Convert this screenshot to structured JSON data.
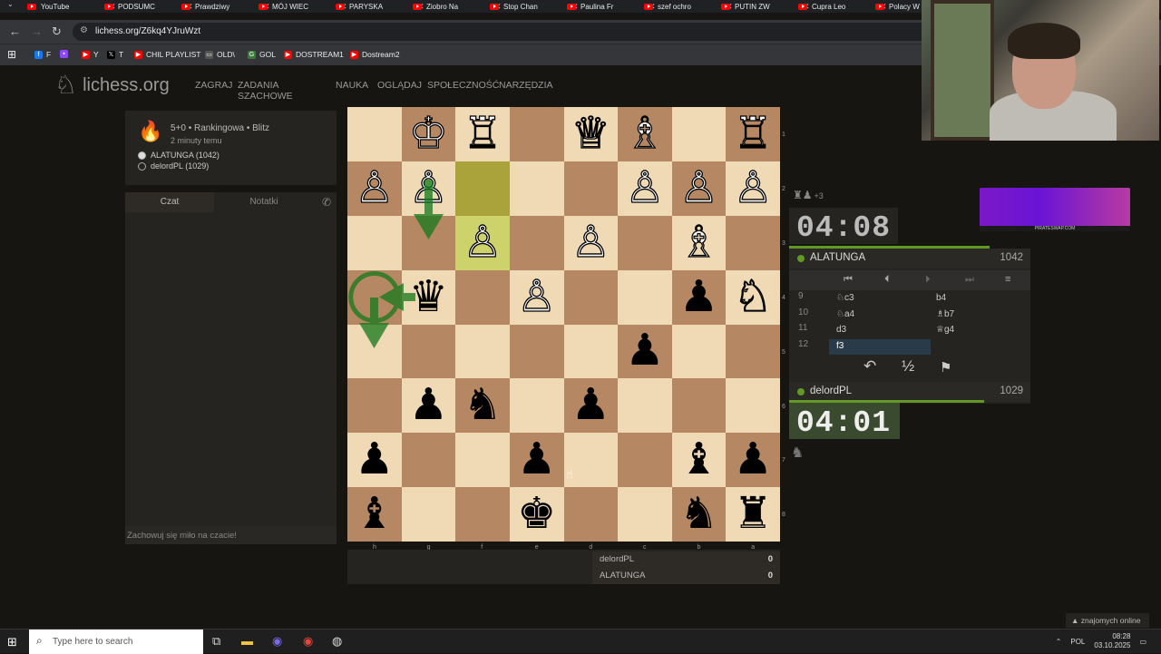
{
  "browser": {
    "tabs": [
      {
        "label": "YouTube",
        "icon": "youtube-icon"
      },
      {
        "label": "PODSUMC",
        "icon": "youtube-icon"
      },
      {
        "label": "Prawdziwy",
        "icon": "youtube-icon"
      },
      {
        "label": "MÓJ WIEC",
        "icon": "youtube-icon"
      },
      {
        "label": "PARYSKA",
        "icon": "youtube-icon"
      },
      {
        "label": "Ziobro Na",
        "icon": "youtube-icon"
      },
      {
        "label": "Stop Chan",
        "icon": "youtube-icon"
      },
      {
        "label": "Paulina Fr",
        "icon": "youtube-icon"
      },
      {
        "label": "szef ochro",
        "icon": "youtube-icon"
      },
      {
        "label": "PUTIN ZW",
        "icon": "youtube-icon"
      },
      {
        "label": "Cupra Leo",
        "icon": "youtube-icon"
      },
      {
        "label": "Polacy W",
        "icon": "youtube-icon"
      }
    ],
    "url": "lichess.org/Z6kq4YJruWzt",
    "bookmarks": [
      {
        "label": "F",
        "icon": "facebook-icon",
        "color": "#1877f2"
      },
      {
        "label": "",
        "icon": "twitch-icon",
        "color": "#9146ff"
      },
      {
        "label": "Y",
        "icon": "youtube-icon",
        "color": "#ff0000"
      },
      {
        "label": "T",
        "icon": "x-icon",
        "color": "#000000"
      },
      {
        "label": "CHIL PLAYLIST",
        "icon": "youtube-icon",
        "color": "#ff0000"
      },
      {
        "label": "OLD\\",
        "icon": "folder-icon",
        "color": "#555555"
      },
      {
        "label": "GOL",
        "icon": "g-icon",
        "color": "#3a7a3a"
      },
      {
        "label": "DOSTREAM1",
        "icon": "youtube-icon",
        "color": "#ff0000"
      },
      {
        "label": "Dostream2",
        "icon": "youtube-icon",
        "color": "#ff0000"
      }
    ]
  },
  "site": {
    "logo_text": "lichess.org",
    "nav": [
      "ZAGRAJ",
      "ZADANIA SZACHOWE",
      "NAUKA",
      "OGLĄDAJ",
      "SPOŁECZNOŚĆ",
      "NARZĘDZIA"
    ]
  },
  "game": {
    "type": "5+0 • Rankingowa • Blitz",
    "time_ago": "2 minuty temu",
    "white": "ALATUNGA (1042)",
    "black": "delordPL (1029)"
  },
  "chat": {
    "tab_chat": "Czat",
    "tab_notes": "Notatki",
    "placeholder": "Zachowuj się miło na czacie!"
  },
  "board": {
    "orientation": "black",
    "ranks": [
      "1",
      "2",
      "3",
      "4",
      "5",
      "6",
      "7",
      "8"
    ],
    "files": [
      "h",
      "g",
      "f",
      "e",
      "d",
      "c",
      "b",
      "a"
    ],
    "rows": [
      [
        "",
        "♔",
        "♖",
        "",
        "♕",
        "♗",
        "",
        "♖"
      ],
      [
        "♙",
        "♙",
        "",
        "",
        "",
        "♙",
        "♙",
        "♙"
      ],
      [
        "",
        "",
        "♙",
        "",
        "♙",
        "",
        "♗",
        ""
      ],
      [
        "",
        "♛",
        "",
        "♙",
        "",
        "",
        "♟",
        "♘"
      ],
      [
        "",
        "",
        "",
        "",
        "",
        "♟",
        "",
        ""
      ],
      [
        "",
        "♟",
        "♞",
        "",
        "♟",
        "",
        "",
        ""
      ],
      [
        "♟",
        "",
        "",
        "♟",
        "",
        "",
        "♝",
        "♟"
      ],
      [
        "♝",
        "",
        "",
        "♚",
        "",
        "",
        "♞",
        "♜"
      ]
    ],
    "highlights": {
      "from": "f2",
      "to": "f3"
    }
  },
  "score": {
    "rows": [
      {
        "name": "delordPL",
        "score": "0"
      },
      {
        "name": "ALATUNGA",
        "score": "0"
      }
    ]
  },
  "opponent": {
    "material_bonus": "+3",
    "clock": "04:08",
    "name": "ALATUNGA",
    "rating": "1042"
  },
  "player": {
    "clock": "04:01",
    "name": "delordPL",
    "rating": "1029"
  },
  "moves": [
    {
      "num": "9",
      "white": "♘c3",
      "black": "b4"
    },
    {
      "num": "10",
      "white": "♘a4",
      "black": "♗b7"
    },
    {
      "num": "11",
      "white": "d3",
      "black": "♕g4"
    },
    {
      "num": "12",
      "white": "f3",
      "black": ""
    }
  ],
  "actions": {
    "draw_label": "½"
  },
  "footer": {
    "friends_online": "znajomych online"
  },
  "taskbar": {
    "search_placeholder": "Type here to search",
    "lang": "POL",
    "time": "08:28",
    "date": "03.10.2025"
  },
  "ad": {
    "caption": "PIRATESWAP.COM"
  }
}
